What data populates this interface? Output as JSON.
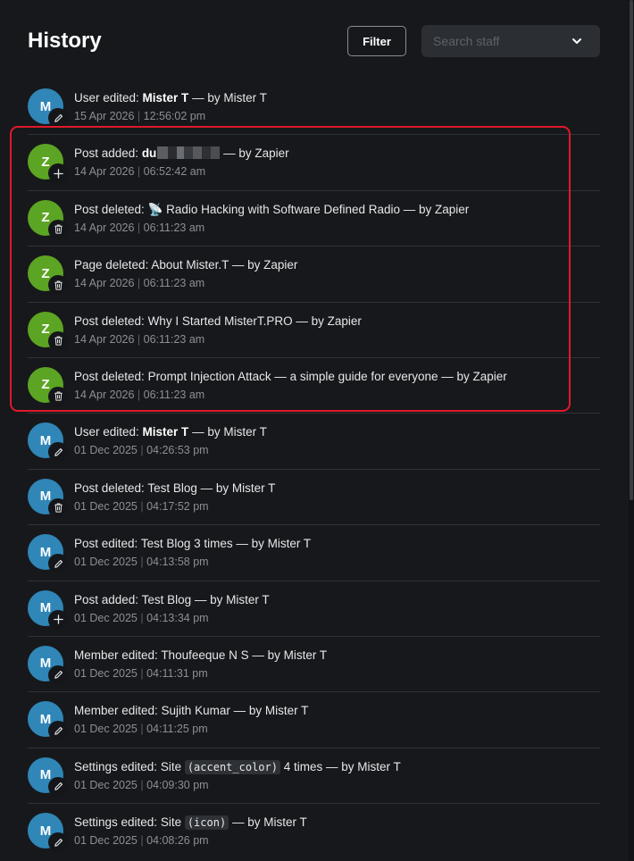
{
  "header": {
    "title": "History",
    "filter_label": "Filter",
    "search_placeholder": "Search staff"
  },
  "colors": {
    "blue_avatar": "#2f86b7",
    "green_avatar": "#5ca423",
    "highlight": "#e0192a"
  },
  "history": [
    {
      "initial": "M",
      "avatar_color": "blue",
      "icon": "pencil-icon",
      "prefix": "User edited: ",
      "subject": "Mister T",
      "subject_bold": true,
      "suffix": " — by Mister T",
      "date": "15 Apr 2026",
      "time": "12:56:02 pm"
    },
    {
      "initial": "Z",
      "avatar_color": "green",
      "icon": "plus-icon",
      "prefix": "Post added: ",
      "subject": "du",
      "subject_bold": true,
      "redacted": true,
      "suffix": " — by Zapier",
      "date": "14 Apr 2026",
      "time": "06:52:42 am"
    },
    {
      "initial": "Z",
      "avatar_color": "green",
      "icon": "trash-icon",
      "prefix": "Post deleted: ",
      "subject": "📡 Radio Hacking with Software Defined Radio",
      "subject_bold": false,
      "suffix": " — by Zapier",
      "date": "14 Apr 2026",
      "time": "06:11:23 am"
    },
    {
      "initial": "Z",
      "avatar_color": "green",
      "icon": "trash-icon",
      "prefix": "Page deleted: ",
      "subject": "About Mister.T",
      "subject_bold": false,
      "suffix": " — by Zapier",
      "date": "14 Apr 2026",
      "time": "06:11:23 am"
    },
    {
      "initial": "Z",
      "avatar_color": "green",
      "icon": "trash-icon",
      "prefix": "Post deleted: ",
      "subject": "Why I Started MisterT.PRO",
      "subject_bold": false,
      "suffix": " — by Zapier",
      "date": "14 Apr 2026",
      "time": "06:11:23 am"
    },
    {
      "initial": "Z",
      "avatar_color": "green",
      "icon": "trash-icon",
      "prefix": "Post deleted: ",
      "subject": "Prompt Injection Attack — a simple guide for everyone",
      "subject_bold": false,
      "suffix": " — by Zapier",
      "date": "14 Apr 2026",
      "time": "06:11:23 am"
    },
    {
      "initial": "M",
      "avatar_color": "blue",
      "icon": "pencil-icon",
      "prefix": "User edited: ",
      "subject": "Mister T",
      "subject_bold": true,
      "suffix": " — by Mister T",
      "date": "01 Dec 2025",
      "time": "04:26:53 pm"
    },
    {
      "initial": "M",
      "avatar_color": "blue",
      "icon": "trash-icon",
      "prefix": "Post deleted: ",
      "subject": "Test Blog",
      "subject_bold": false,
      "suffix": " — by Mister T",
      "date": "01 Dec 2025",
      "time": "04:17:52 pm"
    },
    {
      "initial": "M",
      "avatar_color": "blue",
      "icon": "pencil-icon",
      "prefix": "Post edited: ",
      "subject": "Test Blog 3 times",
      "subject_bold": false,
      "suffix": " — by Mister T",
      "date": "01 Dec 2025",
      "time": "04:13:58 pm"
    },
    {
      "initial": "M",
      "avatar_color": "blue",
      "icon": "plus-icon",
      "prefix": "Post added: ",
      "subject": "Test Blog",
      "subject_bold": false,
      "suffix": " — by Mister T",
      "date": "01 Dec 2025",
      "time": "04:13:34 pm"
    },
    {
      "initial": "M",
      "avatar_color": "blue",
      "icon": "pencil-icon",
      "prefix": "Member edited: ",
      "subject": "Thoufeeque N S",
      "subject_bold": false,
      "suffix": " — by Mister T",
      "date": "01 Dec 2025",
      "time": "04:11:31 pm"
    },
    {
      "initial": "M",
      "avatar_color": "blue",
      "icon": "pencil-icon",
      "prefix": "Member edited: ",
      "subject": "Sujith Kumar",
      "subject_bold": false,
      "suffix": " — by Mister T",
      "date": "01 Dec 2025",
      "time": "04:11:25 pm"
    },
    {
      "initial": "M",
      "avatar_color": "blue",
      "icon": "pencil-icon",
      "prefix": "Settings edited: Site ",
      "code": "(accent_color)",
      "subject": " 4 times",
      "subject_bold": false,
      "suffix": " — by Mister T",
      "date": "01 Dec 2025",
      "time": "04:09:30 pm"
    },
    {
      "initial": "M",
      "avatar_color": "blue",
      "icon": "pencil-icon",
      "prefix": "Settings edited: Site ",
      "code": "(icon)",
      "subject": "",
      "subject_bold": false,
      "suffix": " — by Mister T",
      "date": "01 Dec 2025",
      "time": "04:08:26 pm"
    }
  ]
}
